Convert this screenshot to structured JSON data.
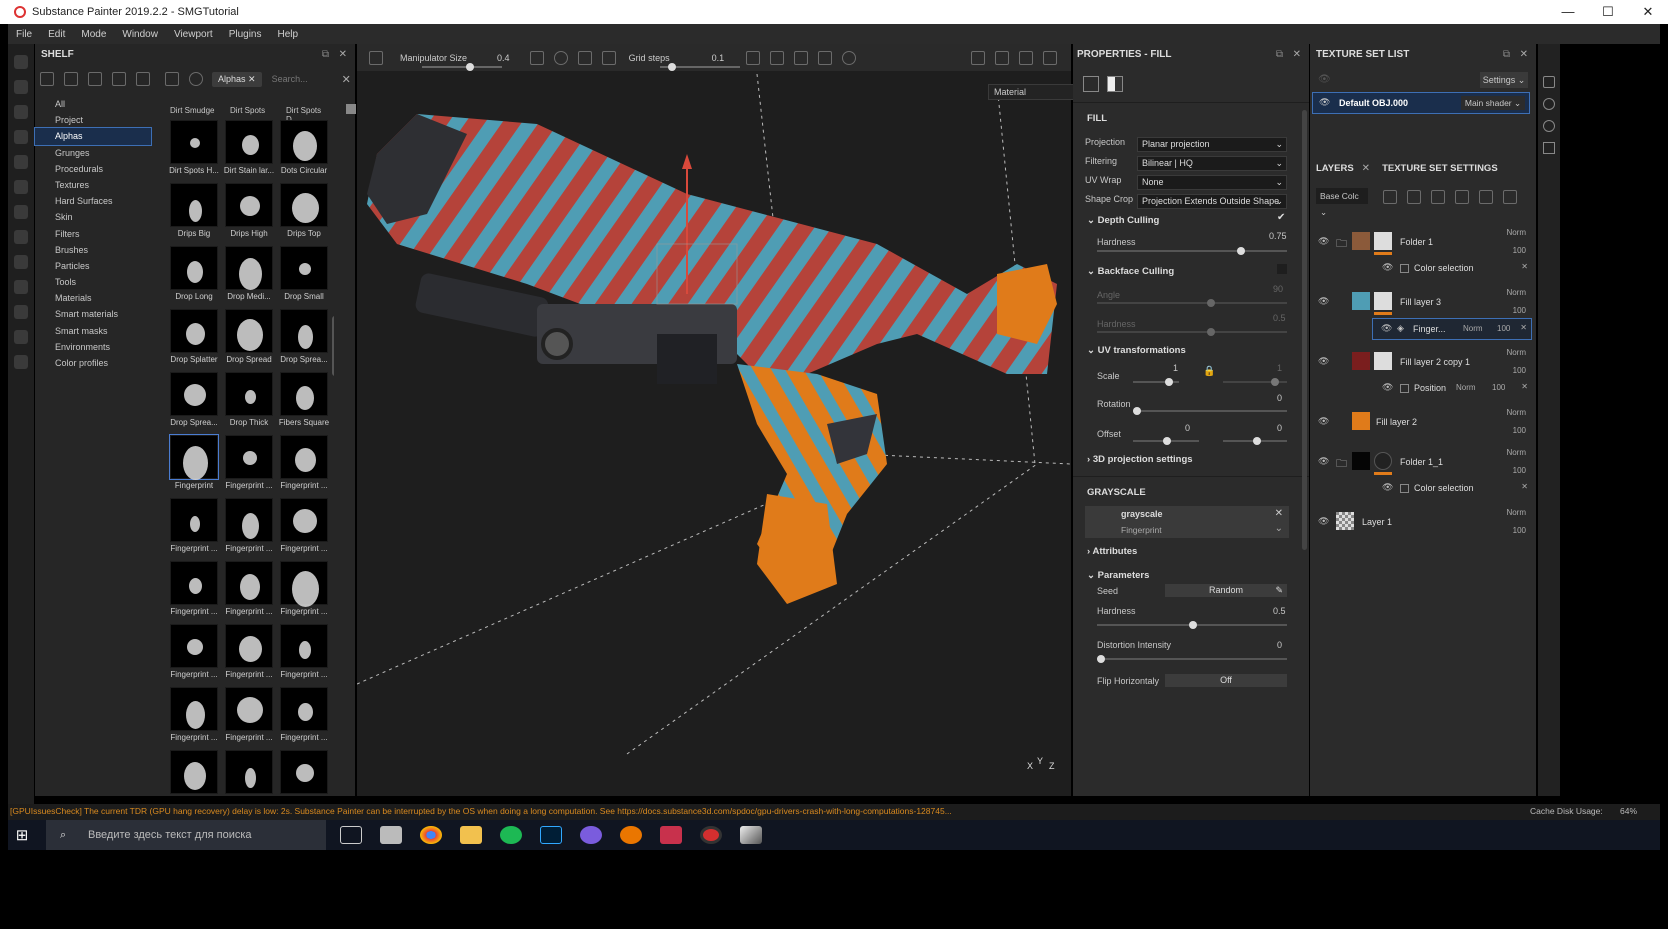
{
  "window": {
    "title": "Substance Painter 2019.2.2 - SMGTutorial",
    "min": "—",
    "max": "☐",
    "close": "✕"
  },
  "menu": [
    "File",
    "Edit",
    "Mode",
    "Window",
    "Viewport",
    "Plugins",
    "Help"
  ],
  "shelf": {
    "title": "SHELF",
    "filter_chip": "Alphas",
    "search_placeholder": "Search...",
    "categories": [
      "All",
      "Project",
      "Alphas",
      "Grunges",
      "Procedurals",
      "Textures",
      "Hard Surfaces",
      "Skin",
      "Filters",
      "Brushes",
      "Particles",
      "Tools",
      "Materials",
      "Smart materials",
      "Smart masks",
      "Environments",
      "Color profiles"
    ],
    "selected_category": "Alphas",
    "top_row": [
      "Dirt Smudge",
      "Dirt Spots",
      "Dirt Spots D..."
    ],
    "items": [
      "Dirt Spots H...",
      "Dirt Stain lar...",
      "Dots Circular",
      "Drips Big",
      "Drips High",
      "Drips Top",
      "Drop Long",
      "Drop Medi...",
      "Drop Small",
      "Drop Splatter",
      "Drop Spread",
      "Drop Sprea...",
      "Drop Sprea...",
      "Drop Thick",
      "Fibers Square",
      "Fingerprint",
      "Fingerprint ...",
      "Fingerprint ...",
      "Fingerprint ...",
      "Fingerprint ...",
      "Fingerprint ...",
      "Fingerprint ...",
      "Fingerprint ...",
      "Fingerprint ...",
      "Fingerprint ...",
      "Fingerprint ...",
      "Fingerprint ...",
      "Fingerprint ...",
      "Fingerprint ...",
      "Fingerprint ...",
      "",
      "",
      ""
    ]
  },
  "viewport": {
    "manipulator_label": "Manipulator Size",
    "manipulator_value": "0.4",
    "grid_label": "Grid steps",
    "grid_value": "0.1",
    "mode_dropdown": "Material",
    "axis_y": "Y",
    "axis_x": "X",
    "axis_z": "Z"
  },
  "properties": {
    "title": "PROPERTIES - FILL",
    "fill_section": "FILL",
    "projection_label": "Projection",
    "projection_value": "Planar projection",
    "filtering_label": "Filtering",
    "filtering_value": "Bilinear | HQ",
    "uvwrap_label": "UV Wrap",
    "uvwrap_value": "None",
    "shapecrop_label": "Shape Crop",
    "shapecrop_value": "Projection Extends Outside Shape",
    "depth_culling": "Depth Culling",
    "hardness_label": "Hardness",
    "hardness_value": "0.75",
    "backface_culling": "Backface Culling",
    "angle_label": "Angle",
    "angle_value": "90",
    "bf_hardness_label": "Hardness",
    "bf_hardness_value": "0.5",
    "uv_transformations": "UV transformations",
    "scale_label": "Scale",
    "scale_value": "1",
    "scale_value2": "1",
    "rotation_label": "Rotation",
    "rotation_value": "0",
    "offset_label": "Offset",
    "offset_value": "0",
    "offset_value2": "0",
    "projection_3d": "3D projection settings",
    "grayscale_section": "GRAYSCALE",
    "grayscale_name": "grayscale",
    "grayscale_res": "Fingerprint",
    "attributes": "Attributes",
    "parameters": "Parameters",
    "seed_label": "Seed",
    "seed_value": "Random",
    "p_hardness_label": "Hardness",
    "p_hardness_value": "0.5",
    "distortion_label": "Distortion Intensity",
    "distortion_value": "0",
    "flip_label": "Flip Horizontaly",
    "flip_value": "Off"
  },
  "texture_set": {
    "title": "TEXTURE SET LIST",
    "settings": "Settings",
    "set_name": "Default OBJ.000",
    "shader": "Main shader"
  },
  "layers": {
    "tab_layers": "LAYERS",
    "tab_settings": "TEXTURE SET SETTINGS",
    "channel": "Base Colc",
    "rows": [
      {
        "name": "Folder 1",
        "blend": "Norm",
        "opacity": "100"
      },
      {
        "name": "Color selection",
        "blend": "",
        "opacity": ""
      },
      {
        "name": "Fill layer 3",
        "blend": "Norm",
        "opacity": "100"
      },
      {
        "name": "Finger...",
        "blend": "Norm",
        "opacity": "100"
      },
      {
        "name": "Fill layer 2 copy 1",
        "blend": "Norm",
        "opacity": "100"
      },
      {
        "name": "Position",
        "blend": "Norm",
        "opacity": "100"
      },
      {
        "name": "Fill layer 2",
        "blend": "Norm",
        "opacity": "100"
      },
      {
        "name": "Folder 1_1",
        "blend": "Norm",
        "opacity": "100"
      },
      {
        "name": "Color selection",
        "blend": "",
        "opacity": ""
      },
      {
        "name": "Layer 1",
        "blend": "Norm",
        "opacity": "100"
      }
    ]
  },
  "status": {
    "message": "[GPUIssuesCheck] The current TDR (GPU hang recovery) delay is low: 2s. Substance Painter can be interrupted by the OS when doing a long computation. See https://docs.substance3d.com/spdoc/gpu-drivers-crash-with-long-computations-128745...",
    "cache": "Cache Disk Usage:",
    "cache_value": "64%"
  },
  "taskbar": {
    "search_placeholder": "Введите здесь текст для поиска"
  },
  "colors": {
    "accent": "#3d6fb5",
    "orange": "#e07b1a",
    "teal": "#4a9bb5",
    "red": "#b23a3a"
  }
}
